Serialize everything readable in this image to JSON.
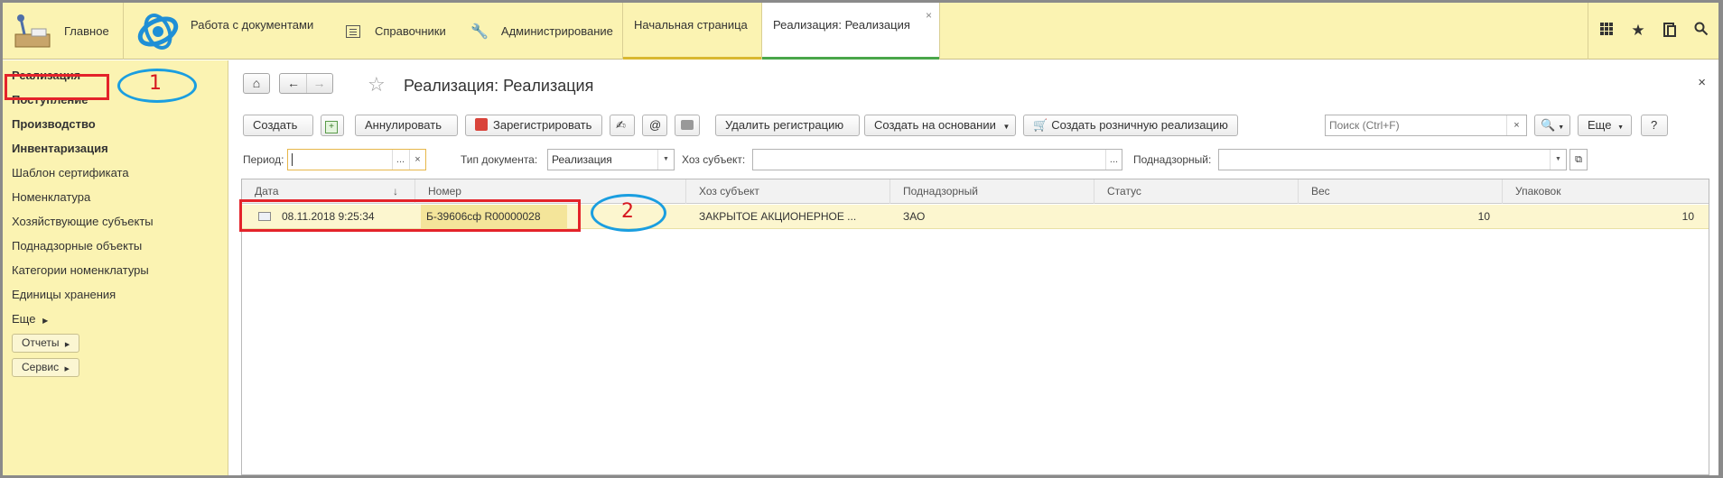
{
  "topbar": {
    "main": "Главное",
    "docs": "Работа с документами",
    "refs": "Справочники",
    "admin": "Администрирование",
    "tabs": [
      {
        "label": "Начальная страница"
      },
      {
        "label": "Реализация: Реализация"
      }
    ],
    "close_glyph": "×"
  },
  "sidebar": {
    "items": [
      "Реализация",
      "Поступление",
      "Производство",
      "Инвентаризация",
      "Шаблон сертификата",
      "Номенклатура",
      "Хозяйствующие субъекты",
      "Поднадзорные объекты",
      "Категории номенклатуры",
      "Единицы хранения",
      "Еще"
    ],
    "reports": "Отчеты",
    "service": "Сервис"
  },
  "content": {
    "title": "Реализация: Реализация",
    "toolbar": {
      "create": "Создать",
      "annul": "Аннулировать",
      "register": "Зарегистрировать",
      "email": "@",
      "delete_reg": "Удалить регистрацию",
      "create_based": "Создать на основании",
      "create_retail": "Создать розничную реализацию",
      "search_placeholder": "Поиск (Ctrl+F)",
      "more": "Еще",
      "help": "?"
    },
    "filters": {
      "period_label": "Период:",
      "doctype_label": "Тип документа:",
      "doctype_value": "Реализация",
      "subject_label": "Хоз субъект:",
      "supervised_label": "Поднадзорный:"
    },
    "table": {
      "columns": [
        "Дата",
        "Номер",
        "Хоз субъект",
        "Поднадзорный",
        "Статус",
        "Вес",
        "Упаковок"
      ],
      "rows": [
        {
          "date": "08.11.2018 9:25:34",
          "number": "Б-39606сф  R00000028",
          "subject": "ЗАКРЫТОЕ АКЦИОНЕРНОЕ ...",
          "supervised": "ЗАО",
          "status": "",
          "weight": "10",
          "packages": "10"
        }
      ]
    }
  },
  "annotations": {
    "marker1": "1",
    "marker2": "2"
  },
  "colors": {
    "panel": "#fbf3b2",
    "selected_row": "#fcf6cf",
    "annotation_red": "#e4232a",
    "annotation_blue": "#1a9ee0"
  }
}
